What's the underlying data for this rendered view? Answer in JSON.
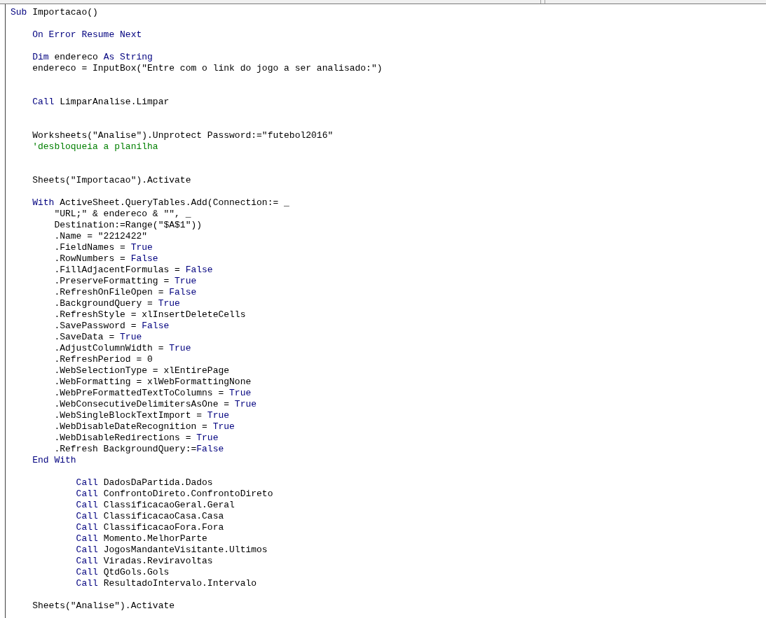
{
  "code_lines": [
    {
      "kind": "code",
      "tokens": [
        {
          "kind": "keyword",
          "text": "Sub"
        },
        {
          "kind": "text",
          "text": " Importacao()"
        }
      ]
    },
    {
      "kind": "blank"
    },
    {
      "kind": "code",
      "tokens": [
        {
          "kind": "keyword",
          "text": "    On Error Resume Next"
        }
      ]
    },
    {
      "kind": "blank"
    },
    {
      "kind": "code",
      "tokens": [
        {
          "kind": "keyword",
          "text": "    Dim"
        },
        {
          "kind": "text",
          "text": " endereco "
        },
        {
          "kind": "keyword",
          "text": "As String"
        }
      ]
    },
    {
      "kind": "code",
      "tokens": [
        {
          "kind": "text",
          "text": "    endereco = InputBox(\"Entre com o link do jogo a ser analisado:\")"
        }
      ]
    },
    {
      "kind": "blank"
    },
    {
      "kind": "blank"
    },
    {
      "kind": "code",
      "tokens": [
        {
          "kind": "keyword",
          "text": "    Call"
        },
        {
          "kind": "text",
          "text": " LimparAnalise.Limpar"
        }
      ]
    },
    {
      "kind": "blank"
    },
    {
      "kind": "blank"
    },
    {
      "kind": "code",
      "tokens": [
        {
          "kind": "text",
          "text": "    Worksheets(\"Analise\").Unprotect Password:=\"futebol2016\""
        }
      ]
    },
    {
      "kind": "code",
      "tokens": [
        {
          "kind": "comment",
          "text": "    'desbloqueia a planilha"
        }
      ]
    },
    {
      "kind": "blank"
    },
    {
      "kind": "blank"
    },
    {
      "kind": "code",
      "tokens": [
        {
          "kind": "text",
          "text": "    Sheets(\"Importacao\").Activate"
        }
      ]
    },
    {
      "kind": "blank"
    },
    {
      "kind": "code",
      "tokens": [
        {
          "kind": "keyword",
          "text": "    With"
        },
        {
          "kind": "text",
          "text": " ActiveSheet.QueryTables.Add(Connection:= _"
        }
      ]
    },
    {
      "kind": "code",
      "tokens": [
        {
          "kind": "text",
          "text": "        \"URL;\" & endereco & \"\", _"
        }
      ]
    },
    {
      "kind": "code",
      "tokens": [
        {
          "kind": "text",
          "text": "        Destination:=Range(\"$A$1\"))"
        }
      ]
    },
    {
      "kind": "code",
      "tokens": [
        {
          "kind": "text",
          "text": "        .Name = \"2212422\""
        }
      ]
    },
    {
      "kind": "code",
      "tokens": [
        {
          "kind": "text",
          "text": "        .FieldNames = "
        },
        {
          "kind": "keyword",
          "text": "True"
        }
      ]
    },
    {
      "kind": "code",
      "tokens": [
        {
          "kind": "text",
          "text": "        .RowNumbers = "
        },
        {
          "kind": "keyword",
          "text": "False"
        }
      ]
    },
    {
      "kind": "code",
      "tokens": [
        {
          "kind": "text",
          "text": "        .FillAdjacentFormulas = "
        },
        {
          "kind": "keyword",
          "text": "False"
        }
      ]
    },
    {
      "kind": "code",
      "tokens": [
        {
          "kind": "text",
          "text": "        .PreserveFormatting = "
        },
        {
          "kind": "keyword",
          "text": "True"
        }
      ]
    },
    {
      "kind": "code",
      "tokens": [
        {
          "kind": "text",
          "text": "        .RefreshOnFileOpen = "
        },
        {
          "kind": "keyword",
          "text": "False"
        }
      ]
    },
    {
      "kind": "code",
      "tokens": [
        {
          "kind": "text",
          "text": "        .BackgroundQuery = "
        },
        {
          "kind": "keyword",
          "text": "True"
        }
      ]
    },
    {
      "kind": "code",
      "tokens": [
        {
          "kind": "text",
          "text": "        .RefreshStyle = xlInsertDeleteCells"
        }
      ]
    },
    {
      "kind": "code",
      "tokens": [
        {
          "kind": "text",
          "text": "        .SavePassword = "
        },
        {
          "kind": "keyword",
          "text": "False"
        }
      ]
    },
    {
      "kind": "code",
      "tokens": [
        {
          "kind": "text",
          "text": "        .SaveData = "
        },
        {
          "kind": "keyword",
          "text": "True"
        }
      ]
    },
    {
      "kind": "code",
      "tokens": [
        {
          "kind": "text",
          "text": "        .AdjustColumnWidth = "
        },
        {
          "kind": "keyword",
          "text": "True"
        }
      ]
    },
    {
      "kind": "code",
      "tokens": [
        {
          "kind": "text",
          "text": "        .RefreshPeriod = 0"
        }
      ]
    },
    {
      "kind": "code",
      "tokens": [
        {
          "kind": "text",
          "text": "        .WebSelectionType = xlEntirePage"
        }
      ]
    },
    {
      "kind": "code",
      "tokens": [
        {
          "kind": "text",
          "text": "        .WebFormatting = xlWebFormattingNone"
        }
      ]
    },
    {
      "kind": "code",
      "tokens": [
        {
          "kind": "text",
          "text": "        .WebPreFormattedTextToColumns = "
        },
        {
          "kind": "keyword",
          "text": "True"
        }
      ]
    },
    {
      "kind": "code",
      "tokens": [
        {
          "kind": "text",
          "text": "        .WebConsecutiveDelimitersAsOne = "
        },
        {
          "kind": "keyword",
          "text": "True"
        }
      ]
    },
    {
      "kind": "code",
      "tokens": [
        {
          "kind": "text",
          "text": "        .WebSingleBlockTextImport = "
        },
        {
          "kind": "keyword",
          "text": "True"
        }
      ]
    },
    {
      "kind": "code",
      "tokens": [
        {
          "kind": "text",
          "text": "        .WebDisableDateRecognition = "
        },
        {
          "kind": "keyword",
          "text": "True"
        }
      ]
    },
    {
      "kind": "code",
      "tokens": [
        {
          "kind": "text",
          "text": "        .WebDisableRedirections = "
        },
        {
          "kind": "keyword",
          "text": "True"
        }
      ]
    },
    {
      "kind": "code",
      "tokens": [
        {
          "kind": "text",
          "text": "        .Refresh BackgroundQuery:="
        },
        {
          "kind": "keyword",
          "text": "False"
        }
      ]
    },
    {
      "kind": "code",
      "tokens": [
        {
          "kind": "keyword",
          "text": "    End With"
        }
      ]
    },
    {
      "kind": "blank"
    },
    {
      "kind": "code",
      "tokens": [
        {
          "kind": "keyword",
          "text": "            Call"
        },
        {
          "kind": "text",
          "text": " DadosDaPartida.Dados"
        }
      ]
    },
    {
      "kind": "code",
      "tokens": [
        {
          "kind": "keyword",
          "text": "            Call"
        },
        {
          "kind": "text",
          "text": " ConfrontoDireto.ConfrontoDireto"
        }
      ]
    },
    {
      "kind": "code",
      "tokens": [
        {
          "kind": "keyword",
          "text": "            Call"
        },
        {
          "kind": "text",
          "text": " ClassificacaoGeral.Geral"
        }
      ]
    },
    {
      "kind": "code",
      "tokens": [
        {
          "kind": "keyword",
          "text": "            Call"
        },
        {
          "kind": "text",
          "text": " ClassificacaoCasa.Casa"
        }
      ]
    },
    {
      "kind": "code",
      "tokens": [
        {
          "kind": "keyword",
          "text": "            Call"
        },
        {
          "kind": "text",
          "text": " ClassificacaoFora.Fora"
        }
      ]
    },
    {
      "kind": "code",
      "tokens": [
        {
          "kind": "keyword",
          "text": "            Call"
        },
        {
          "kind": "text",
          "text": " Momento.MelhorParte"
        }
      ]
    },
    {
      "kind": "code",
      "tokens": [
        {
          "kind": "keyword",
          "text": "            Call"
        },
        {
          "kind": "text",
          "text": " JogosMandanteVisitante.Ultimos"
        }
      ]
    },
    {
      "kind": "code",
      "tokens": [
        {
          "kind": "keyword",
          "text": "            Call"
        },
        {
          "kind": "text",
          "text": " Viradas.Reviravoltas"
        }
      ]
    },
    {
      "kind": "code",
      "tokens": [
        {
          "kind": "keyword",
          "text": "            Call"
        },
        {
          "kind": "text",
          "text": " QtdGols.Gols"
        }
      ]
    },
    {
      "kind": "code",
      "tokens": [
        {
          "kind": "keyword",
          "text": "            Call"
        },
        {
          "kind": "text",
          "text": " ResultadoIntervalo.Intervalo"
        }
      ]
    },
    {
      "kind": "blank"
    },
    {
      "kind": "code",
      "tokens": [
        {
          "kind": "text",
          "text": "    Sheets(\"Analise\").Activate"
        }
      ]
    }
  ]
}
